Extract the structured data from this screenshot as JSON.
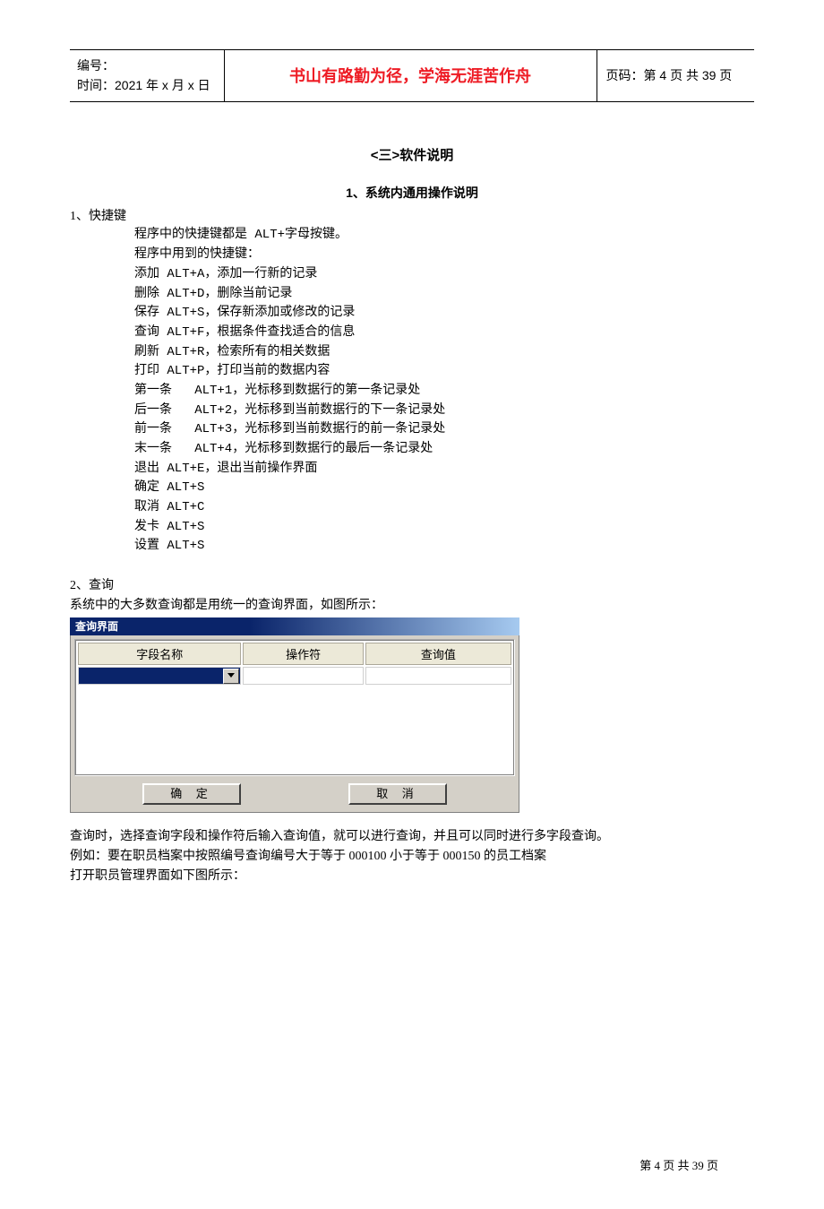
{
  "header": {
    "left_line1": "编号：",
    "left_line2": "时间：2021 年 x 月 x 日",
    "motto": "书山有路勤为径，学海无涯苦作舟",
    "right": "页码：第 4 页  共 39 页"
  },
  "section_title": "<三>软件说明",
  "sub_title": "1、系统内通用操作说明",
  "shortcut_heading": "1、快捷键",
  "shortcut_intro1": "程序中的快捷键都是 ALT+字母按键。",
  "shortcut_intro2": "程序中用到的快捷键：",
  "shortcuts": [
    "添加 ALT+A，添加一行新的记录",
    "删除 ALT+D，删除当前记录",
    "保存 ALT+S，保存新添加或修改的记录",
    "查询 ALT+F，根据条件查找适合的信息",
    "刷新 ALT+R，检索所有的相关数据",
    "打印 ALT+P，打印当前的数据内容",
    "第一条   ALT+1，光标移到数据行的第一条记录处",
    "后一条   ALT+2，光标移到当前数据行的下一条记录处",
    "前一条   ALT+3，光标移到当前数据行的前一条记录处",
    "末一条   ALT+4，光标移到数据行的最后一条记录处",
    "退出 ALT+E，退出当前操作界面",
    "确定 ALT+S",
    "取消 ALT+C",
    "发卡 ALT+S",
    "设置 ALT+S"
  ],
  "query_heading": "2、查询",
  "query_intro": "系统中的大多数查询都是用统一的查询界面，如图所示：",
  "dialog": {
    "title": "查询界面",
    "col_field": "字段名称",
    "col_op": "操作符",
    "col_value": "查询值",
    "ok_label": "确 定",
    "cancel_label": "取 消"
  },
  "after": {
    "line1": "查询时，选择查询字段和操作符后输入查询值，就可以进行查询，并且可以同时进行多字段查询。",
    "line2": "例如：要在职员档案中按照编号查询编号大于等于 000100 小于等于 000150 的员工档案",
    "line3": "打开职员管理界面如下图所示："
  },
  "footer": "第 4 页 共 39 页"
}
